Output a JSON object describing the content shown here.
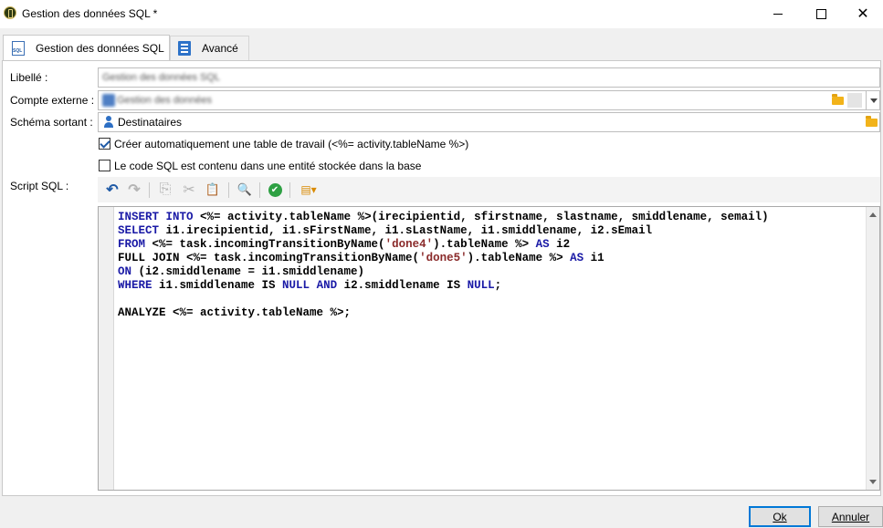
{
  "window": {
    "title": "Gestion des données SQL *",
    "min_icon": "minimize-icon",
    "max_icon": "maximize-icon",
    "close_icon": "close-icon",
    "close_glyph": "✕"
  },
  "tabs": [
    {
      "label": "Gestion des données SQL",
      "icon": "sql-file-icon",
      "active": true
    },
    {
      "label": "Avancé",
      "icon": "settings-list-icon",
      "active": false
    }
  ],
  "form": {
    "libelle_label": "Libellé :",
    "libelle_value": "Gestion des données SQL",
    "compte_label": "Compte externe :",
    "compte_value": "Gestion des données",
    "schema_label": "Schéma sortant :",
    "schema_value": "Destinataires",
    "checkbox_auto_label": "Créer automatiquement une table de travail (<%= activity.tableName %>)",
    "checkbox_auto_checked": true,
    "checkbox_stored_label": "Le code SQL est contenu dans une entité stockée dans la base",
    "checkbox_stored_checked": false,
    "script_label": "Script SQL :"
  },
  "toolbar": {
    "undo": "↶",
    "redo": "↷",
    "copy": "⎘",
    "cut": "✂",
    "paste": "📋",
    "find": "🔍",
    "check": "✔",
    "insert": "▤▾"
  },
  "editor": {
    "lines": [
      "INSERT INTO <%= activity.tableName %>(irecipientid, sfirstname, slastname, smiddlename, semail)",
      "SELECT i1.irecipientid, i1.sFirstName, i1.sLastName, i1.smiddlename, i2.sEmail",
      "FROM <%= task.incomingTransitionByName('done4').tableName %> AS i2",
      "FULL JOIN <%= task.incomingTransitionByName('done5').tableName %> AS i1",
      "ON (i2.smiddlename = i1.smiddlename)",
      "WHERE i1.smiddlename IS NULL AND i2.smiddlename IS NULL;",
      "",
      "ANALYZE <%= activity.tableName %>;"
    ]
  },
  "footer": {
    "ok_label": "Ok",
    "cancel_label": "Annuler"
  },
  "colors": {
    "keyword": "#1a1aa6",
    "string": "#8a2a2a",
    "folder": "#f2b31a",
    "accent": "#0078d7"
  }
}
